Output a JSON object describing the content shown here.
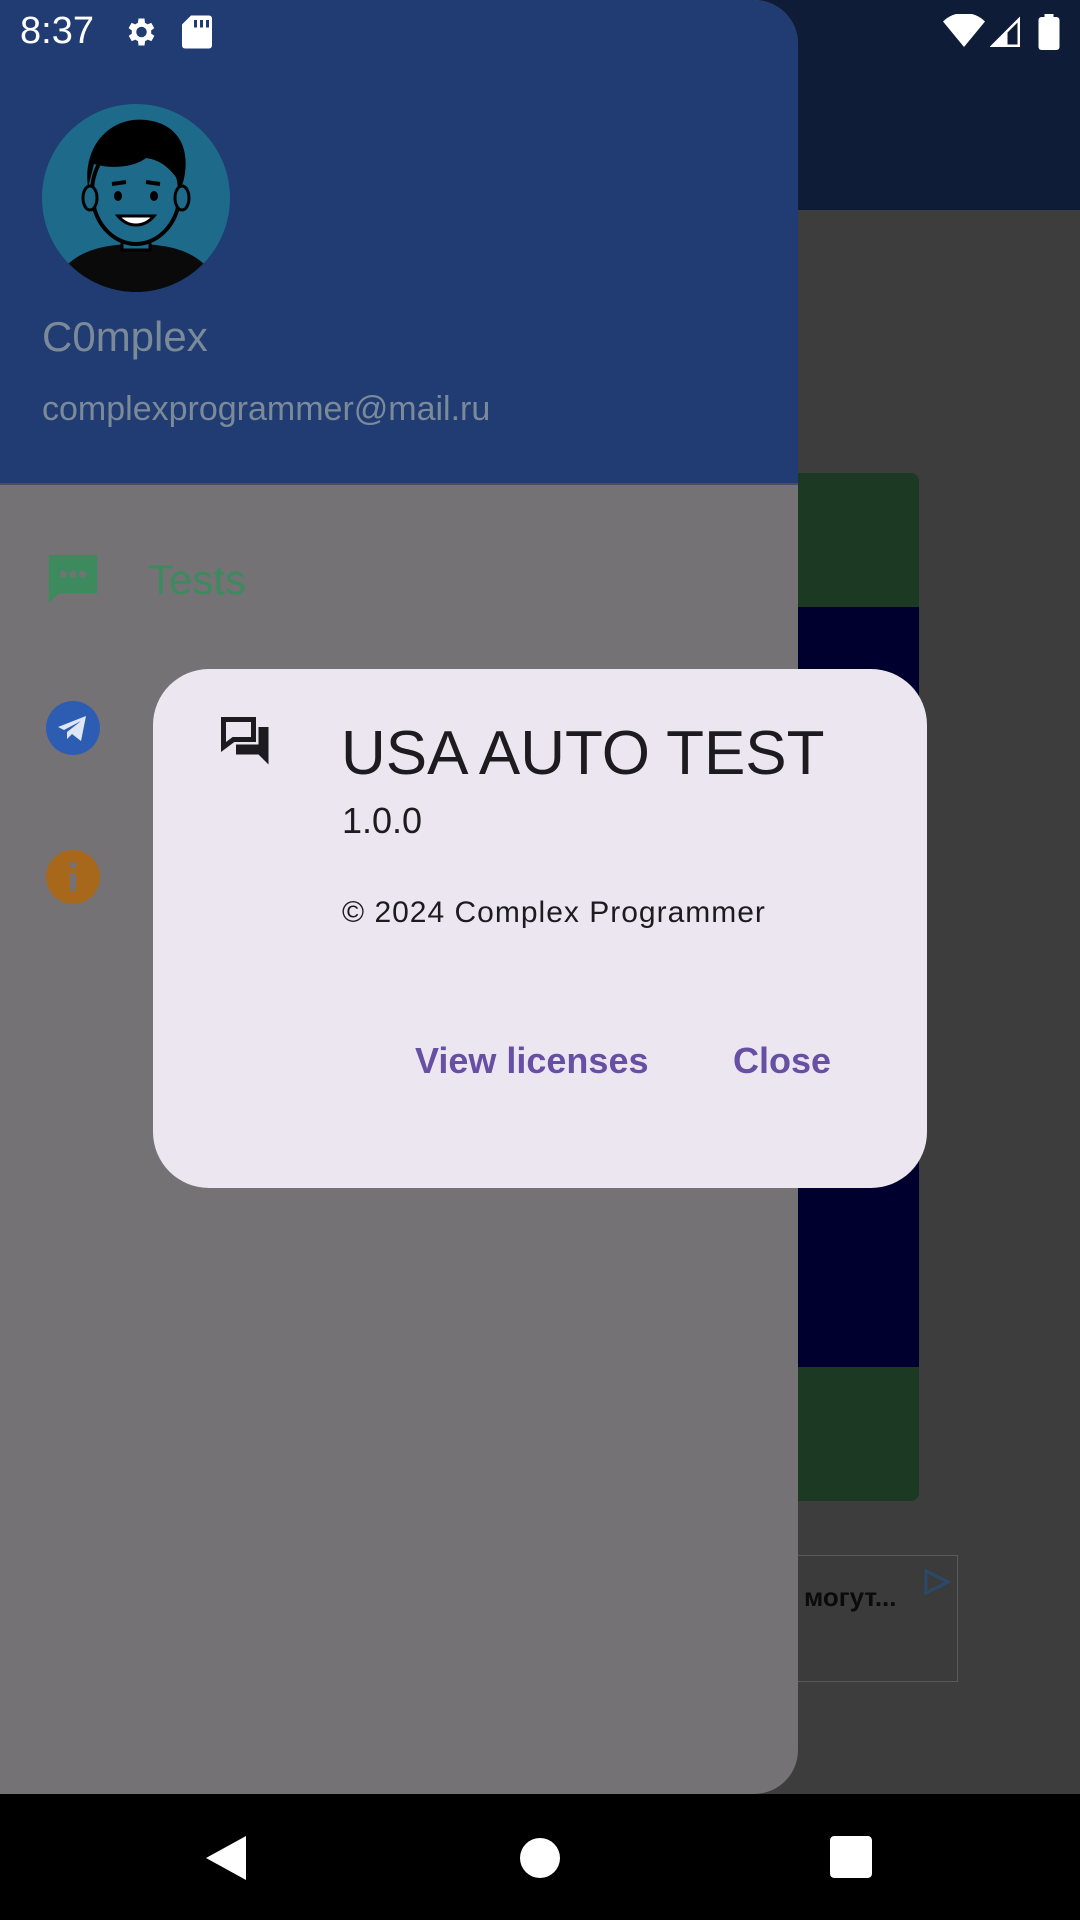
{
  "status_bar": {
    "time": "8:37",
    "left_icons": [
      "gear-icon",
      "sd-card-icon"
    ],
    "right_icons": [
      "wifi-icon",
      "signal-icon",
      "battery-icon"
    ]
  },
  "drawer": {
    "header": {
      "name": "C0mplex",
      "email": "complexprogrammer@mail.ru"
    },
    "items": [
      {
        "icon": "chat-bubble-icon",
        "label": "Tests",
        "color": "#3e8a5f"
      },
      {
        "icon": "telegram-icon",
        "label": "",
        "color": "#2d5db3"
      },
      {
        "icon": "info-icon",
        "label": "",
        "color": "#a8681c"
      }
    ]
  },
  "background": {
    "ad_text": "могут..."
  },
  "dialog": {
    "icon": "forum-icon",
    "title": "USA AUTO TEST",
    "version": "1.0.0",
    "copyright": "© 2024 Complex Programmer",
    "buttons": {
      "view_licenses": "View licenses",
      "close": "Close"
    },
    "accent": "#6750a4"
  }
}
